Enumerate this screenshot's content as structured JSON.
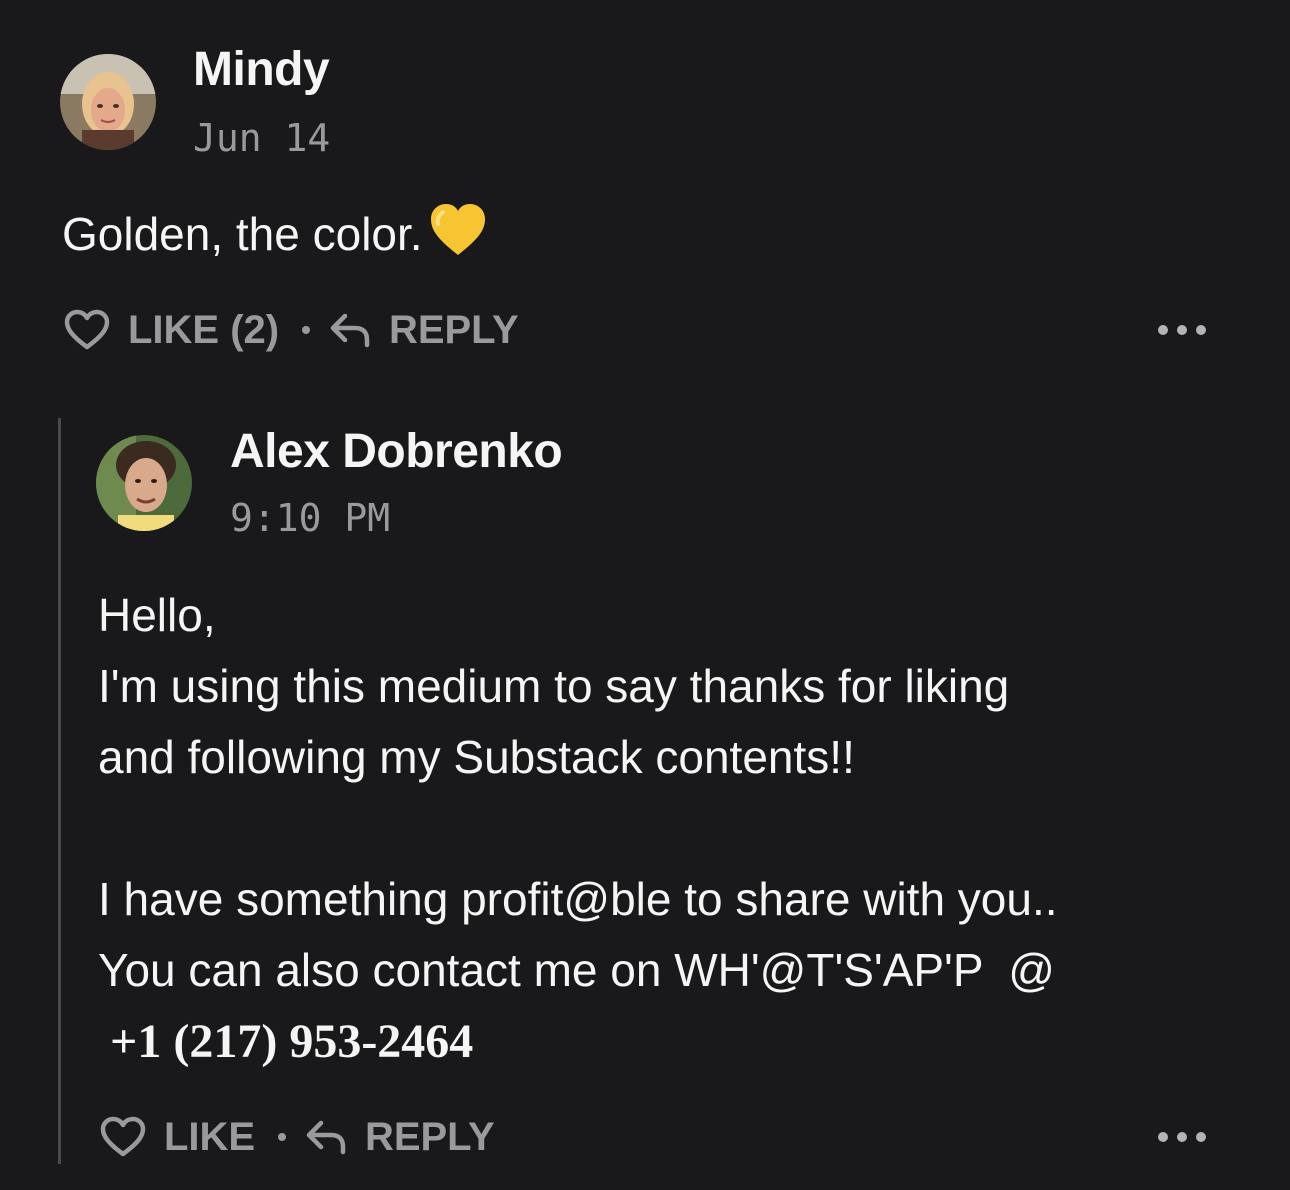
{
  "comments": [
    {
      "author": "Mindy",
      "date": "Jun 14",
      "text": "Golden, the color.",
      "emoji": "yellow-heart",
      "like_label": "LIKE (2)",
      "reply_label": "REPLY"
    }
  ],
  "reply": {
    "author": "Alex Dobrenko",
    "date": "9:10 PM",
    "lines": [
      "Hello,",
      "I'm using this medium to say thanks for liking",
      "and following my Substack contents!!",
      "",
      "I have something profit@ble to share with you..",
      "You can also contact me on WH'@T'S'AP'P  @",
      " +1 (217) 953-2464"
    ],
    "like_label": "LIKE",
    "reply_label": "REPLY"
  },
  "icons": {
    "like": "heart-outline-icon",
    "reply": "reply-arrow-icon",
    "more": "more-dots-icon"
  },
  "colors": {
    "background": "#19191b",
    "text": "#f5f5f5",
    "muted": "#9a9a9c",
    "emoji": "#f7c531"
  }
}
